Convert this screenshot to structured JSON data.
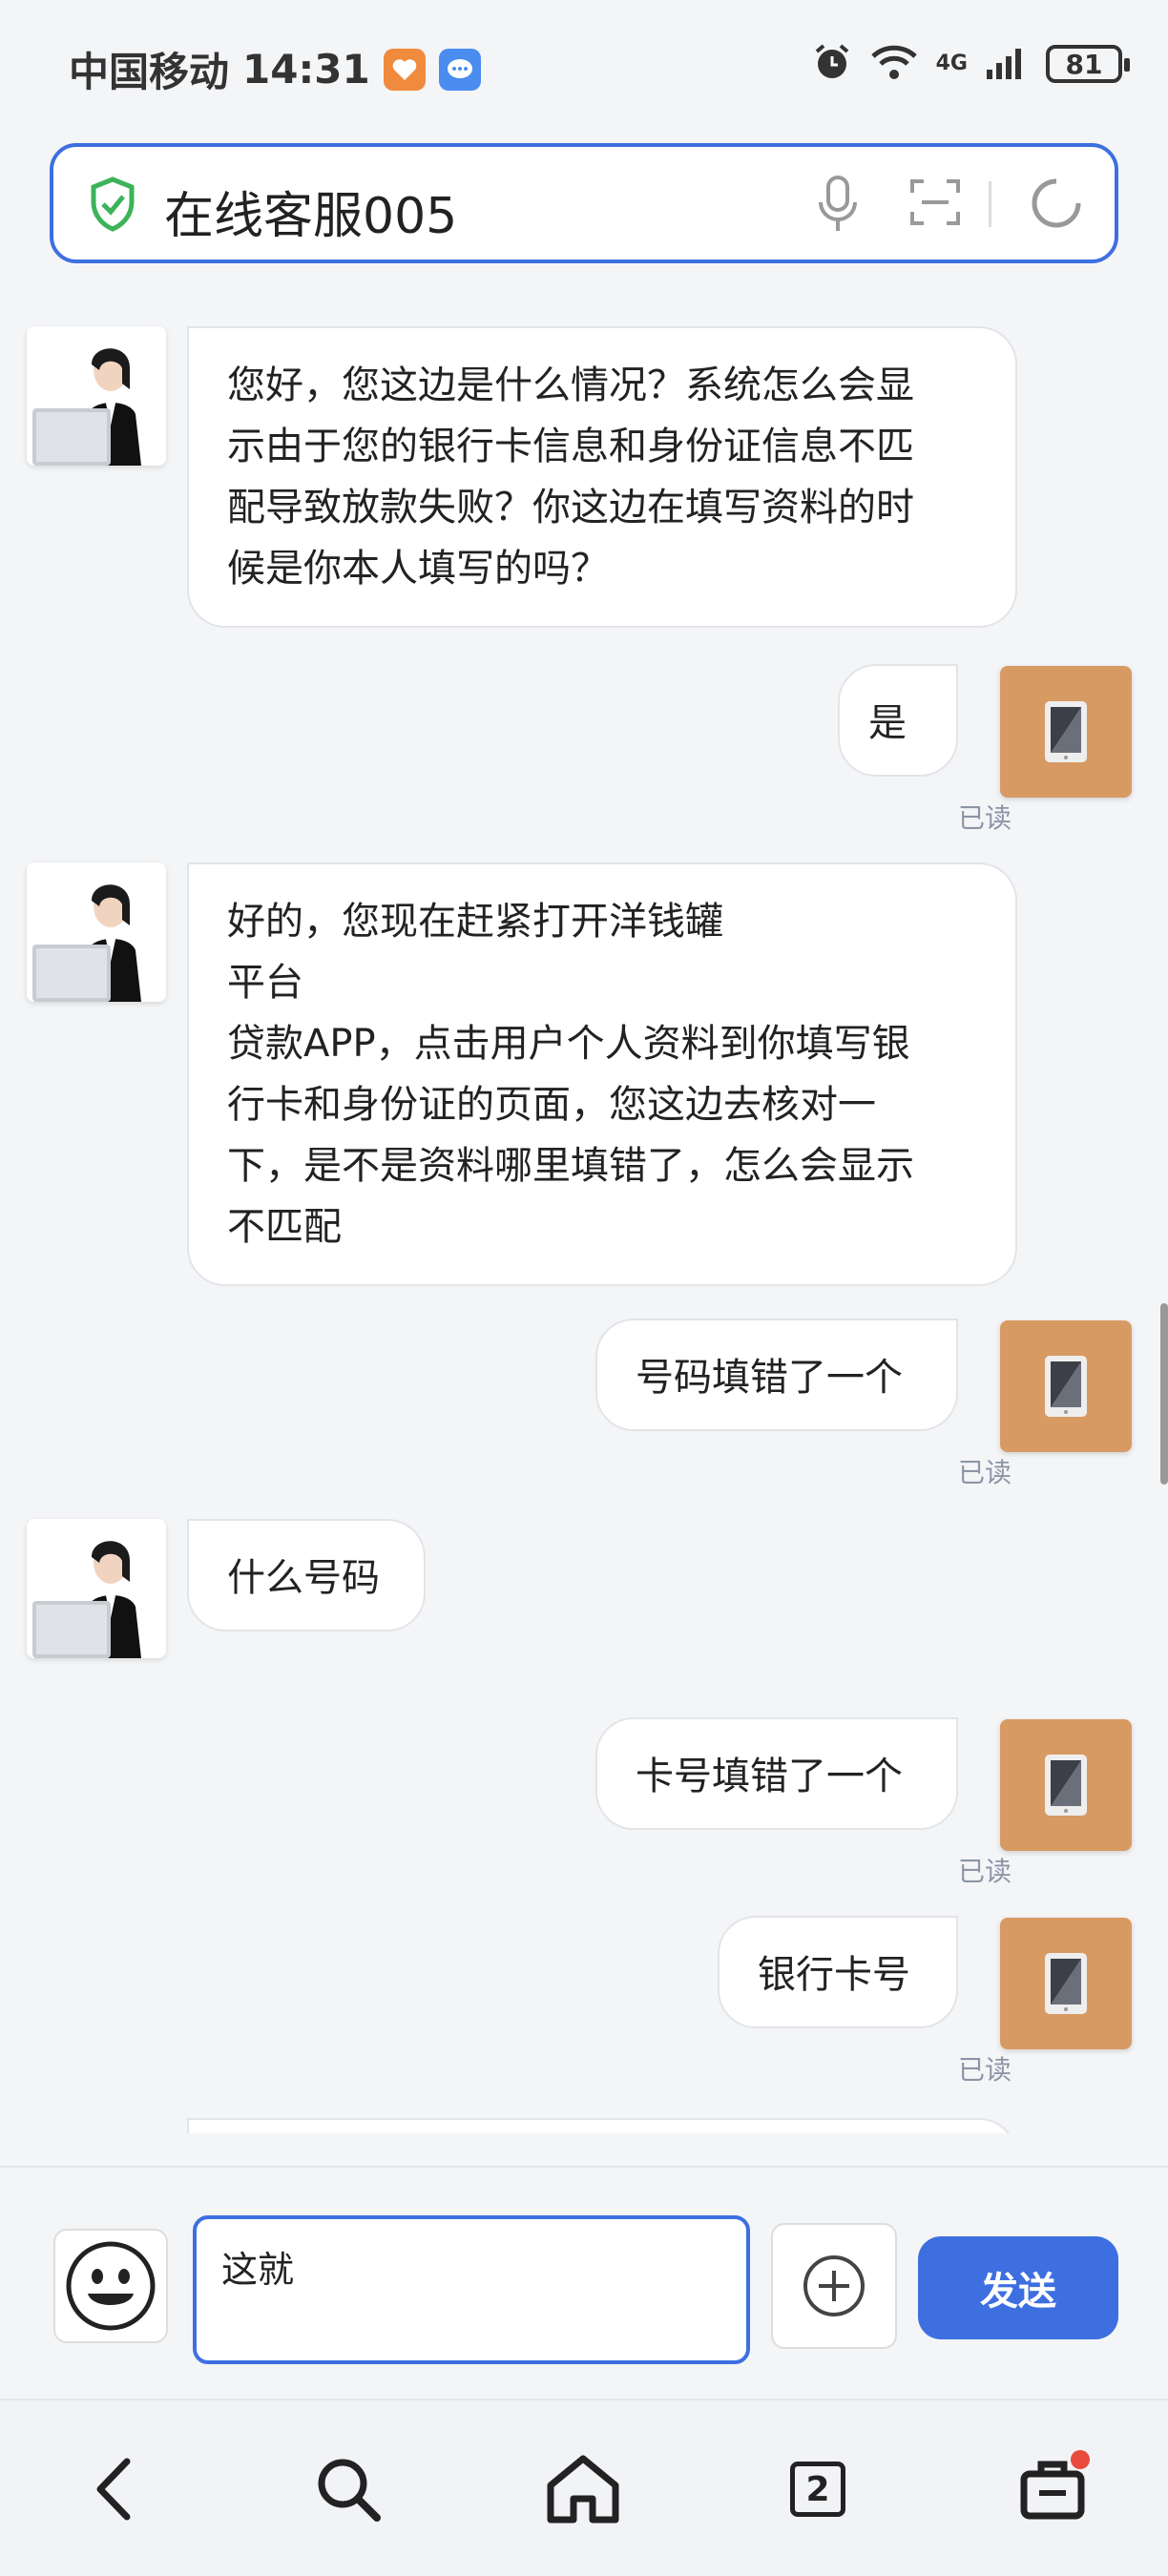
{
  "status_bar": {
    "carrier": "中国移动",
    "time": "14:31",
    "network": "4G",
    "battery": "81"
  },
  "title_bar": {
    "title": "在线客服005"
  },
  "messages": [
    {
      "sender": "agent",
      "text": "您好，您这边是什么情况？系统怎么会显\n示由于您的银行卡信息和身份证信息不匹\n配导致放款失败？你这边在填写资料的时\n候是你本人填写的吗？"
    },
    {
      "sender": "user",
      "text": "是",
      "status": "已读"
    },
    {
      "sender": "agent",
      "text": "好的，您现在赶紧打开洋钱罐\n平台\n贷款APP，点击用户个人资料到你填写银\n行卡和身份证的页面，您这边去核对一\n下，是不是资料哪里填错了，怎么会显示\n不匹配"
    },
    {
      "sender": "user",
      "text": "号码填错了一个",
      "status": "已读"
    },
    {
      "sender": "agent",
      "text": "什么号码"
    },
    {
      "sender": "user",
      "text": "卡号填错了一个",
      "status": "已读"
    },
    {
      "sender": "user",
      "text": "银行卡号",
      "status": "已读"
    }
  ],
  "input": {
    "value": "这就",
    "send_label": "发送"
  },
  "nav": {
    "tab_count": "2"
  },
  "colors": {
    "accent": "#3d6fe0",
    "user_avatar": "#d89a63",
    "read_status": "#8c95a6"
  }
}
